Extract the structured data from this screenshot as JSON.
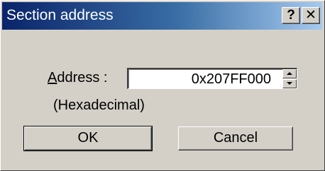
{
  "window": {
    "title": "Section address",
    "help_label": "?",
    "close_label": "✕"
  },
  "form": {
    "address_mnemonic": "A",
    "address_label_rest": "ddress :",
    "address_value": "0x207FF000",
    "hex_note": "(Hexadecimal)"
  },
  "buttons": {
    "ok_label": "OK",
    "cancel_label": "Cancel"
  },
  "colors": {
    "titlebar_start": "#0a246a",
    "titlebar_end": "#a6caf0",
    "face": "#d4d0c8"
  },
  "icons": {
    "help": "help-icon",
    "close": "close-icon",
    "spin_up": "chevron-up-icon",
    "spin_down": "chevron-down-icon"
  }
}
